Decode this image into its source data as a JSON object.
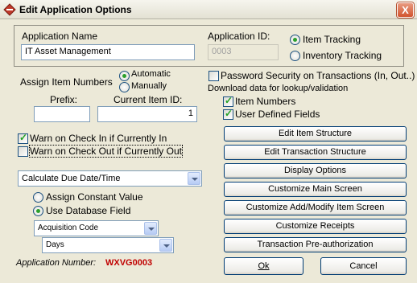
{
  "window": {
    "title": "Edit Application Options",
    "close_glyph": "X"
  },
  "app": {
    "name_label": "Application Name",
    "name_value": "IT Asset Management",
    "id_label": "Application ID:",
    "id_value": "0003",
    "type_options": [
      {
        "label": "Item Tracking",
        "selected": true
      },
      {
        "label": "Inventory Tracking",
        "selected": false
      }
    ]
  },
  "numbering": {
    "label": "Assign Item Numbers",
    "automatic_label": "Automatic",
    "manually_label": "Manually",
    "prefix_label": "Prefix:",
    "current_id_label": "Current Item ID:",
    "prefix_value": "",
    "current_id_value": "1"
  },
  "warnings": {
    "check_in_label": "Warn on Check In if Currently In",
    "check_in_checked": true,
    "check_out_label": "Warn on Check Out if Currently Out",
    "check_out_checked": false
  },
  "due_date": {
    "select_value": "Calculate Due Date/Time",
    "constant_label": "Assign Constant Value",
    "database_label": "Use Database Field",
    "field_value": "Acquisition Code",
    "unit_value": "Days"
  },
  "footer": {
    "app_number_label": "Application Number:",
    "app_number_value": "WXVG0003"
  },
  "security": {
    "password_label": "Password Security on Transactions (In, Out..)",
    "password_checked": false,
    "download_label": "Download data for lookup/validation",
    "item_numbers_label": "Item Numbers",
    "item_numbers_checked": true,
    "user_fields_label": "User Defined Fields",
    "user_fields_checked": true
  },
  "actions": [
    "Edit Item Structure",
    "Edit Transaction Structure",
    "Display Options",
    "Customize Main Screen",
    "Customize Add/Modify Item Screen",
    "Customize Receipts",
    "Transaction Pre-authorization"
  ],
  "dialog_buttons": {
    "ok": "Ok",
    "cancel": "Cancel"
  },
  "colors": {
    "app_number": "#c00000",
    "title_icon": "#c0392b"
  }
}
